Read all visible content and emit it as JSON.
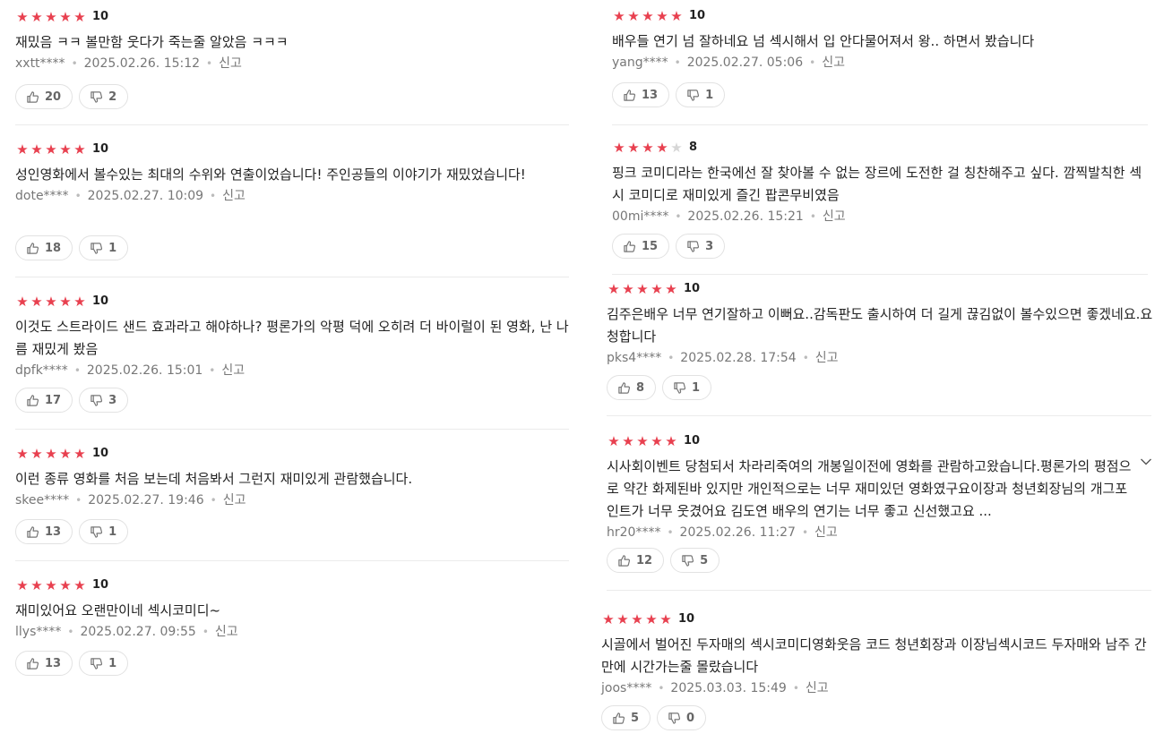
{
  "report_label": "신고",
  "reviews": [
    {
      "stars": 5,
      "score": "10",
      "text": "재밌음 ㅋㅋ 볼만함 웃다가 죽는줄 알았음 ㅋㅋㅋ",
      "user": "xxtt****",
      "date": "2025.02.26. 15:12",
      "likes": "20",
      "dislikes": "2"
    },
    {
      "stars": 5,
      "score": "10",
      "text": "성인영화에서 볼수있는 최대의 수위와 연출이었습니다! 주인공들의 이야기가 재밌었습니다!",
      "user": "dote****",
      "date": "2025.02.27. 10:09",
      "likes": "18",
      "dislikes": "1"
    },
    {
      "stars": 5,
      "score": "10",
      "text": "이것도 스트라이드 샌드 효과라고 해야하나? 평론가의 악평 덕에 오히려 더 바이럴이 된 영화, 난 나름 재밌게 봤음",
      "user": "dpfk****",
      "date": "2025.02.26. 15:01",
      "likes": "17",
      "dislikes": "3"
    },
    {
      "stars": 5,
      "score": "10",
      "text": "이런 종류 영화를 처음 보는데 처음봐서 그런지 재미있게 관람했습니다.",
      "user": "skee****",
      "date": "2025.02.27. 19:46",
      "likes": "13",
      "dislikes": "1"
    },
    {
      "stars": 5,
      "score": "10",
      "text": "재미있어요 오랜만이네 섹시코미디~",
      "user": "llys****",
      "date": "2025.02.27. 09:55",
      "likes": "13",
      "dislikes": "1"
    },
    {
      "stars": 5,
      "score": "10",
      "text": "배우들 연기 넘 잘하네요 넘 섹시해서 입 안다물어져서 왕.. 하면서 봤습니다",
      "user": "yang****",
      "date": "2025.02.27. 05:06",
      "likes": "13",
      "dislikes": "1"
    },
    {
      "stars": 4,
      "score": "8",
      "text": "핑크 코미디라는 한국에선 잘 찾아볼 수 없는 장르에 도전한 걸 칭찬해주고 싶다. 깜찍발칙한 섹시 코미디로 재미있게 즐긴 팝콘무비였음",
      "user": "00mi****",
      "date": "2025.02.26. 15:21",
      "likes": "15",
      "dislikes": "3"
    },
    {
      "stars": 5,
      "score": "10",
      "text": "김주은배우 너무 연기잘하고 이뻐요..감독판도 출시하여 더 길게 끊김없이 볼수있으면 좋겠네요.요청합니다",
      "user": "pks4****",
      "date": "2025.02.28. 17:54",
      "likes": "8",
      "dislikes": "1"
    },
    {
      "stars": 5,
      "score": "10",
      "text": "시사회이벤트 당첨되서 차라리죽여의 개봉일이전에 영화를 관람하고왔습니다.평론가의 평점으로 약간 화제된바 있지만 개인적으로는 너무 재미있던 영화였구요이장과 청년회장님의 개그포인트가 너무 웃겼어요 김도연 배우의 연기는 너무 좋고 신선했고요 ...",
      "user": "hr20****",
      "date": "2025.02.26. 11:27",
      "likes": "12",
      "dislikes": "5",
      "more_icon": "chevron-down-icon"
    },
    {
      "stars": 5,
      "score": "10",
      "text": "시골에서 벌어진 두자매의 섹시코미디영화웃음 코드 청년회장과 이장님섹시코드 두자매와 남주 간만에 시간가는줄 몰랐습니다",
      "user": "joos****",
      "date": "2025.03.03. 15:49",
      "likes": "5",
      "dislikes": "0"
    }
  ],
  "colors": {
    "star_filled": "#e8404f",
    "star_empty": "#d6d6d6",
    "meta_text": "#777777",
    "border": "#e2e2e2"
  },
  "icons": {
    "like": "thumbs-up-icon",
    "dislike": "thumbs-down-icon",
    "star": "star-icon"
  }
}
